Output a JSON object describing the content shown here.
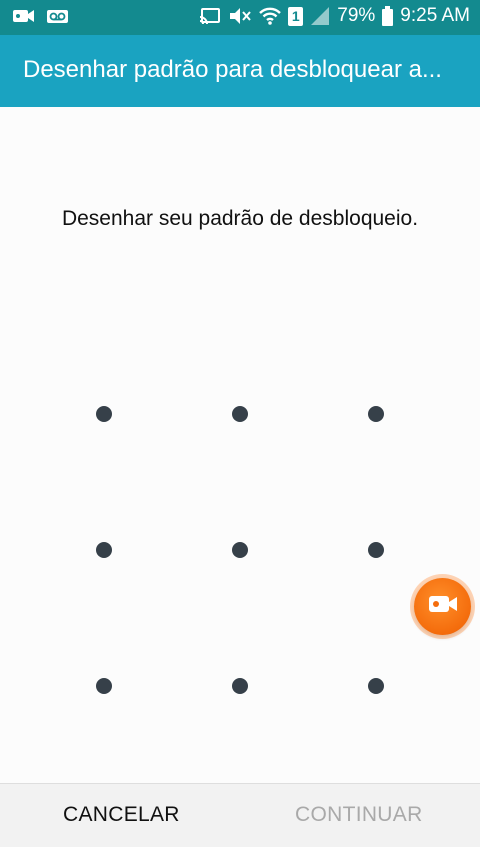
{
  "status_bar": {
    "battery_percent": "79%",
    "time": "9:25 AM",
    "sim_slot": "1",
    "left_icons": [
      "video-camera-icon",
      "voicemail-icon"
    ],
    "right_icons": [
      "screen-cast-icon",
      "mute-icon",
      "wifi-icon",
      "sim-icon",
      "signal-icon",
      "battery-icon"
    ]
  },
  "app_bar": {
    "title": "Desenhar padrão para desbloquear a..."
  },
  "main": {
    "instruction": "Desenhar seu padrão de desbloqueio.",
    "pattern_dots": [
      {
        "row": 1,
        "col": 1
      },
      {
        "row": 1,
        "col": 2
      },
      {
        "row": 1,
        "col": 3
      },
      {
        "row": 2,
        "col": 1
      },
      {
        "row": 2,
        "col": 2
      },
      {
        "row": 2,
        "col": 3
      },
      {
        "row": 3,
        "col": 1
      },
      {
        "row": 3,
        "col": 2
      },
      {
        "row": 3,
        "col": 3
      }
    ],
    "floating_button_icon": "video-camera-icon"
  },
  "bottom_bar": {
    "cancel_label": "CANCELAR",
    "continue_label": "CONTINUAR"
  },
  "colors": {
    "status_bar": "#138a8f",
    "app_bar": "#1aa3c1",
    "dot": "#364049",
    "fab": "#f46c0c",
    "continue_disabled": "#a9a9a9"
  }
}
